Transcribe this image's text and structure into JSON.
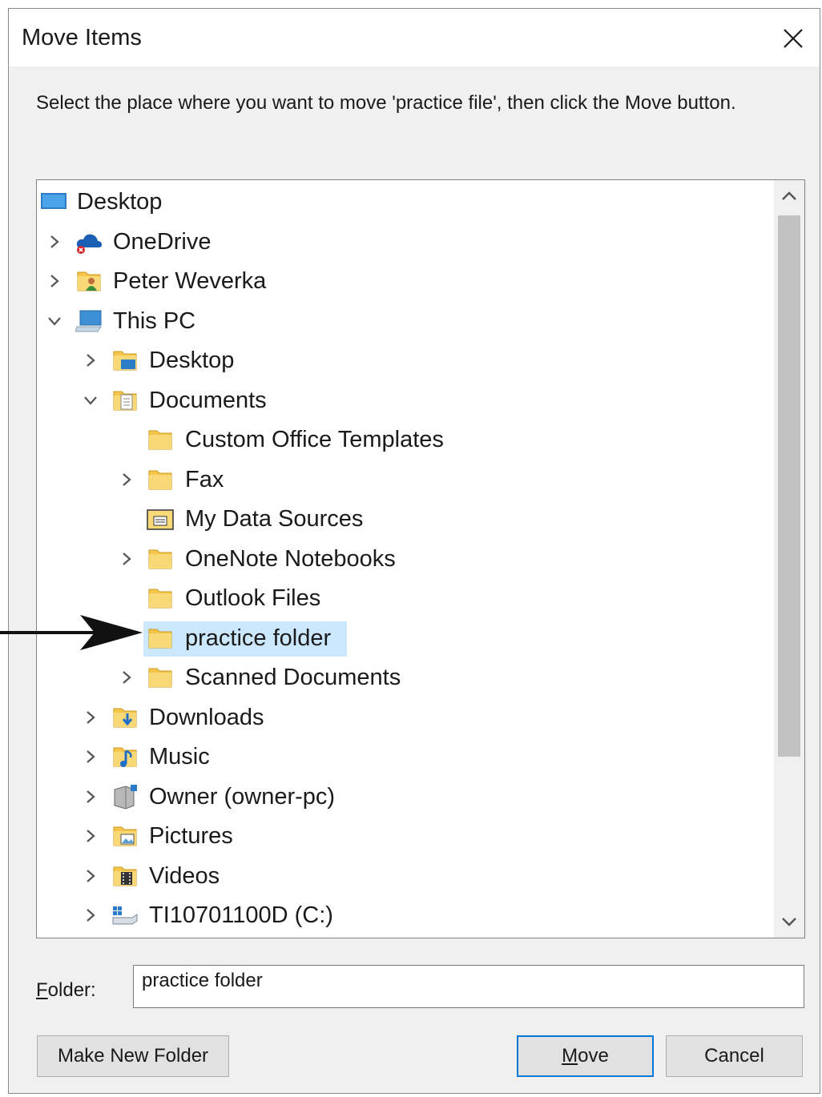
{
  "window": {
    "title": "Move Items",
    "close_icon": "close-icon"
  },
  "instruction": "Select the place where you want to move 'practice file', then click the Move button.",
  "tree": {
    "items": [
      {
        "label": "Desktop",
        "icon": "desktop-icon",
        "expander": "none",
        "level": 0
      },
      {
        "label": "OneDrive",
        "icon": "onedrive-icon",
        "expander": "collapsed",
        "level": 1
      },
      {
        "label": "Peter Weverka",
        "icon": "user-folder-icon",
        "expander": "collapsed",
        "level": 1
      },
      {
        "label": "This PC",
        "icon": "computer-icon",
        "expander": "expanded",
        "level": 1
      },
      {
        "label": "Desktop",
        "icon": "desktop-folder-icon",
        "expander": "collapsed",
        "level": 2
      },
      {
        "label": "Documents",
        "icon": "documents-folder-icon",
        "expander": "expanded",
        "level": 2
      },
      {
        "label": "Custom Office Templates",
        "icon": "folder-icon",
        "expander": "none",
        "level": 3
      },
      {
        "label": "Fax",
        "icon": "folder-icon",
        "expander": "collapsed",
        "level": 3
      },
      {
        "label": "My Data Sources",
        "icon": "data-sources-folder-icon",
        "expander": "none",
        "level": 3
      },
      {
        "label": "OneNote Notebooks",
        "icon": "folder-icon",
        "expander": "collapsed",
        "level": 3
      },
      {
        "label": "Outlook Files",
        "icon": "folder-icon",
        "expander": "none",
        "level": 3
      },
      {
        "label": "practice folder",
        "icon": "folder-icon",
        "expander": "none",
        "level": 3,
        "selected": true
      },
      {
        "label": "Scanned Documents",
        "icon": "folder-icon",
        "expander": "collapsed",
        "level": 3
      },
      {
        "label": "Downloads",
        "icon": "downloads-folder-icon",
        "expander": "collapsed",
        "level": 2
      },
      {
        "label": "Music",
        "icon": "music-folder-icon",
        "expander": "collapsed",
        "level": 2
      },
      {
        "label": "Owner (owner-pc)",
        "icon": "network-drive-icon",
        "expander": "collapsed",
        "level": 2
      },
      {
        "label": "Pictures",
        "icon": "pictures-folder-icon",
        "expander": "collapsed",
        "level": 2
      },
      {
        "label": "Videos",
        "icon": "videos-folder-icon",
        "expander": "collapsed",
        "level": 2
      },
      {
        "label": "TI10701100D (C:)",
        "icon": "drive-icon",
        "expander": "collapsed",
        "level": 2
      }
    ]
  },
  "folder_field": {
    "label": "Folder:",
    "value": "practice folder"
  },
  "buttons": {
    "make_new_folder": "Make New Folder",
    "move": "Move",
    "cancel": "Cancel"
  },
  "colors": {
    "selection": "#cce8ff",
    "folder": "#f6c64a",
    "accent": "#0078d7"
  }
}
